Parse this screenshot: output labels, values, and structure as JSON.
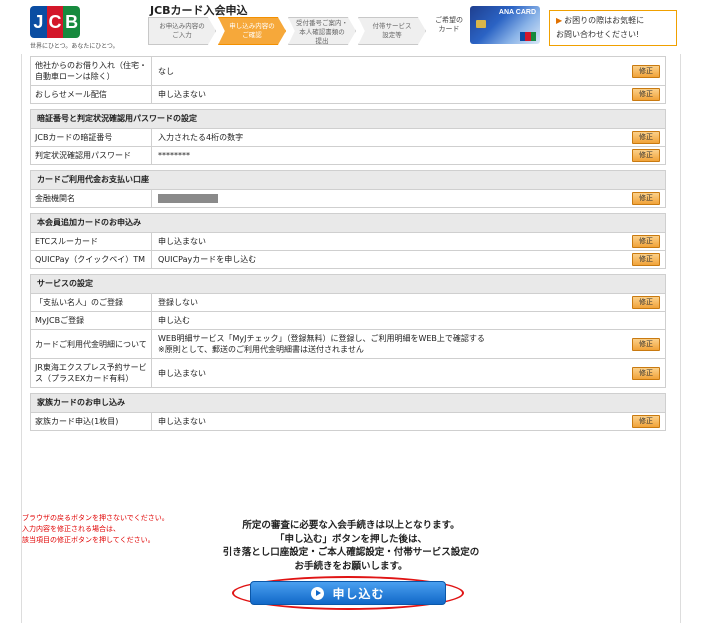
{
  "header": {
    "logo_text": [
      "J",
      "C",
      "B"
    ],
    "tagline": "世界にひとつ。あなたにひとつ。",
    "app_title": "JCBカード入会申込",
    "steps": [
      {
        "line1": "お申込み内容の",
        "line2": "ご入力"
      },
      {
        "line1": "申し込み内容の",
        "line2": "ご確認"
      },
      {
        "line1": "受付番号ご案内・",
        "line2": "本人確認書類の",
        "line3": "提出"
      },
      {
        "line1": "付帯サービス",
        "line2": "設定等"
      }
    ],
    "card_label_line1": "ご希望の",
    "card_label_line2": "カード",
    "card_brand": "ANA CARD",
    "help_line1": "お困りの際はお気軽に",
    "help_line2": "お問い合わせください!"
  },
  "rows_top": [
    {
      "label": "他社からのお借り入れ（住宅・自動車ローンは除く）",
      "value": "なし",
      "edit": "修正"
    },
    {
      "label": "おしらせメール配信",
      "value": "申し込まない",
      "edit": "修正"
    }
  ],
  "sections": [
    {
      "title": "暗証番号と判定状況確認用パスワードの設定",
      "rows": [
        {
          "label": "JCBカードの暗証番号",
          "value": "入力されたる4桁の数字",
          "edit": "修正"
        },
        {
          "label": "判定状況確認用パスワード",
          "value": "********",
          "edit": "修正"
        }
      ]
    },
    {
      "title": "カードご利用代金お支払い口座",
      "rows": [
        {
          "label": "金融機関名",
          "value": "",
          "masked": true,
          "edit": "修正"
        }
      ]
    },
    {
      "title": "本会員追加カードのお申込み",
      "rows": [
        {
          "label": "ETCスルーカード",
          "value": "申し込まない",
          "edit": "修正"
        },
        {
          "label": "QUICPay（クイックペイ）TM",
          "value": "QUICPayカードを申し込む",
          "edit": "修正"
        }
      ]
    },
    {
      "title": "サービスの設定",
      "rows": [
        {
          "label": "「支払い名人」のご登録",
          "value": "登録しない",
          "edit": "修正"
        },
        {
          "label": "MyJCBご登録",
          "value": "申し込む",
          "edit": ""
        },
        {
          "label": "カードご利用代金明細について",
          "value": "WEB明細サービス「MyJチェック」（登録無料）に登録し、ご利用明細をWEB上で確認する",
          "value2": "※原則として、郵送のご利用代金明細書は送付されません",
          "edit": "修正"
        },
        {
          "label": "JR東海エクスプレス予約サービス（プラスEXカード有料）",
          "value": "申し込まない",
          "edit": "修正"
        }
      ]
    },
    {
      "title": "家族カードのお申し込み",
      "rows": [
        {
          "label": "家族カード申込(1枚目)",
          "value": "申し込まない",
          "edit": "修正"
        }
      ]
    }
  ],
  "footer": {
    "note1": "ブラウザの戻るボタンを押さないでください。",
    "note2": "入力内容を修正される場合は、",
    "note3": "該当項目の修正ボタンを押してください。",
    "confirm1": "所定の審査に必要な入会手続きは以上となります。",
    "confirm2": "「申し込む」ボタンを押した後は、",
    "confirm3": "引き落とし口座設定・ご本人確認設定・付帯サービス設定の",
    "confirm4": "お手続きをお願いします。",
    "submit_label": "申し込む"
  },
  "colors": {
    "accent": "#f39000",
    "submit": "#1168c8",
    "highlight_ring": "#e01414"
  }
}
